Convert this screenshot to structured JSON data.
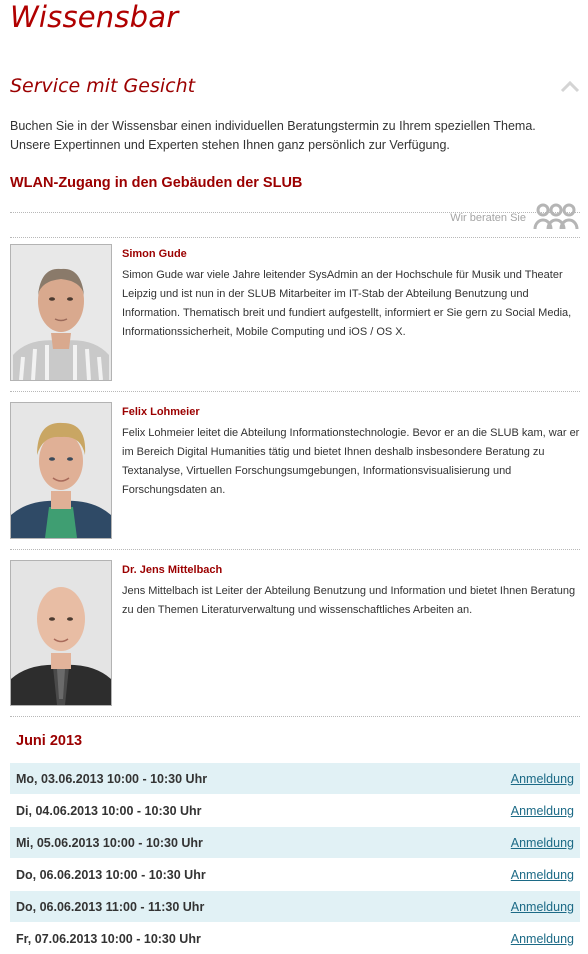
{
  "site": {
    "title": "Wissensbar"
  },
  "section": {
    "title": "Service mit Gesicht"
  },
  "intro": "Buchen Sie in der Wissensbar einen individuellen Beratungstermin zu Ihrem speziellen Thema. Unsere Expertinnen und Experten stehen Ihnen ganz persönlich zur Verfügung.",
  "topic": {
    "title": "WLAN-Zugang in den Gebäuden der SLUB"
  },
  "advisors": {
    "label": "Wir beraten Sie",
    "icon": "people-group-icon",
    "people": [
      {
        "name": "Simon Gude",
        "bio": "Simon Gude war viele Jahre leitender SysAdmin an der Hochschule für Musik und Theater Leipzig und ist nun in der SLUB Mitarbeiter im IT-Stab der Abteilung Benutzung und Information. Thematisch breit und fundiert aufgestellt, informiert er Sie gern zu Social Media, Informationssicherheit, Mobile Computing und iOS / OS X."
      },
      {
        "name": "Felix Lohmeier",
        "bio": "Felix Lohmeier leitet die Abteilung Informationstechnologie. Bevor er an die SLUB kam, war er im Bereich Digital Humanities tätig und bietet Ihnen deshalb insbesondere Beratung zu Textanalyse, Virtuellen Forschungsumgebungen, Informationsvisualisierung und Forschungsdaten an."
      },
      {
        "name": "Dr. Jens Mittelbach",
        "bio": "Jens Mittelbach ist Leiter der Abteilung Benutzung und Information und bietet Ihnen Beratung zu den Themen Literaturverwaltung und wissenschaftliches Arbeiten an."
      }
    ]
  },
  "schedule": {
    "month": "Juni 2013",
    "action_label": "Anmeldung",
    "slots": [
      "Mo, 03.06.2013 10:00 - 10:30 Uhr",
      "Di, 04.06.2013 10:00 - 10:30 Uhr",
      "Mi, 05.06.2013 10:00 - 10:30 Uhr",
      "Do, 06.06.2013 10:00 - 10:30 Uhr",
      "Do, 06.06.2013 11:00 - 11:30 Uhr",
      "Fr, 07.06.2013 10:00 - 10:30 Uhr"
    ]
  },
  "colors": {
    "brand": "#9b0000",
    "row_alt": "#e1f1f5",
    "link": "#1c6a86"
  }
}
